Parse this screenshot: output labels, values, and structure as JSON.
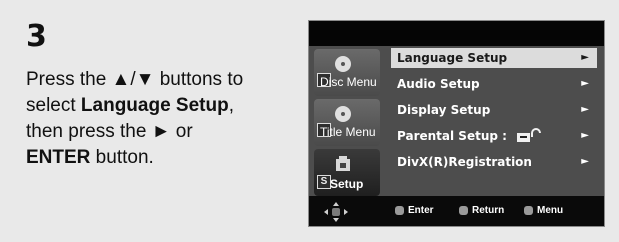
{
  "instruction": {
    "step_number": "3",
    "line1_prefix": "Press the ",
    "buttons_glyphs": "▲/▼",
    "line1_suffix": " buttons to",
    "line2_prefix": "select ",
    "line2_bold": "Language Setup",
    "line2_suffix": ",",
    "line3": "then press the ► or",
    "line4_bold": "ENTER",
    "line4_suffix": " button."
  },
  "screen": {
    "side_tabs": [
      {
        "label": "Disc Menu",
        "icon": "disc-menu-icon"
      },
      {
        "label": "Title Menu",
        "icon": "title-menu-icon"
      },
      {
        "label": "Setup",
        "icon": "setup-icon",
        "box_label": "S"
      }
    ],
    "menu_items": [
      {
        "label": "Language Setup",
        "arrow": "►",
        "selected": true
      },
      {
        "label": "Audio Setup",
        "arrow": "►"
      },
      {
        "label": "Display Setup",
        "arrow": "►"
      },
      {
        "label": "Parental Setup :",
        "arrow": "►",
        "icon": "lock-icon"
      },
      {
        "label": "DivX(R)Registration",
        "arrow": "►"
      }
    ],
    "hints": {
      "enter": "Enter",
      "return": "Return",
      "menu": "Menu"
    }
  },
  "colors": {
    "panel_bg": "#e9e9e9",
    "screen_bg": "#4d4d4d",
    "selected_bg": "#dcdcdc"
  }
}
